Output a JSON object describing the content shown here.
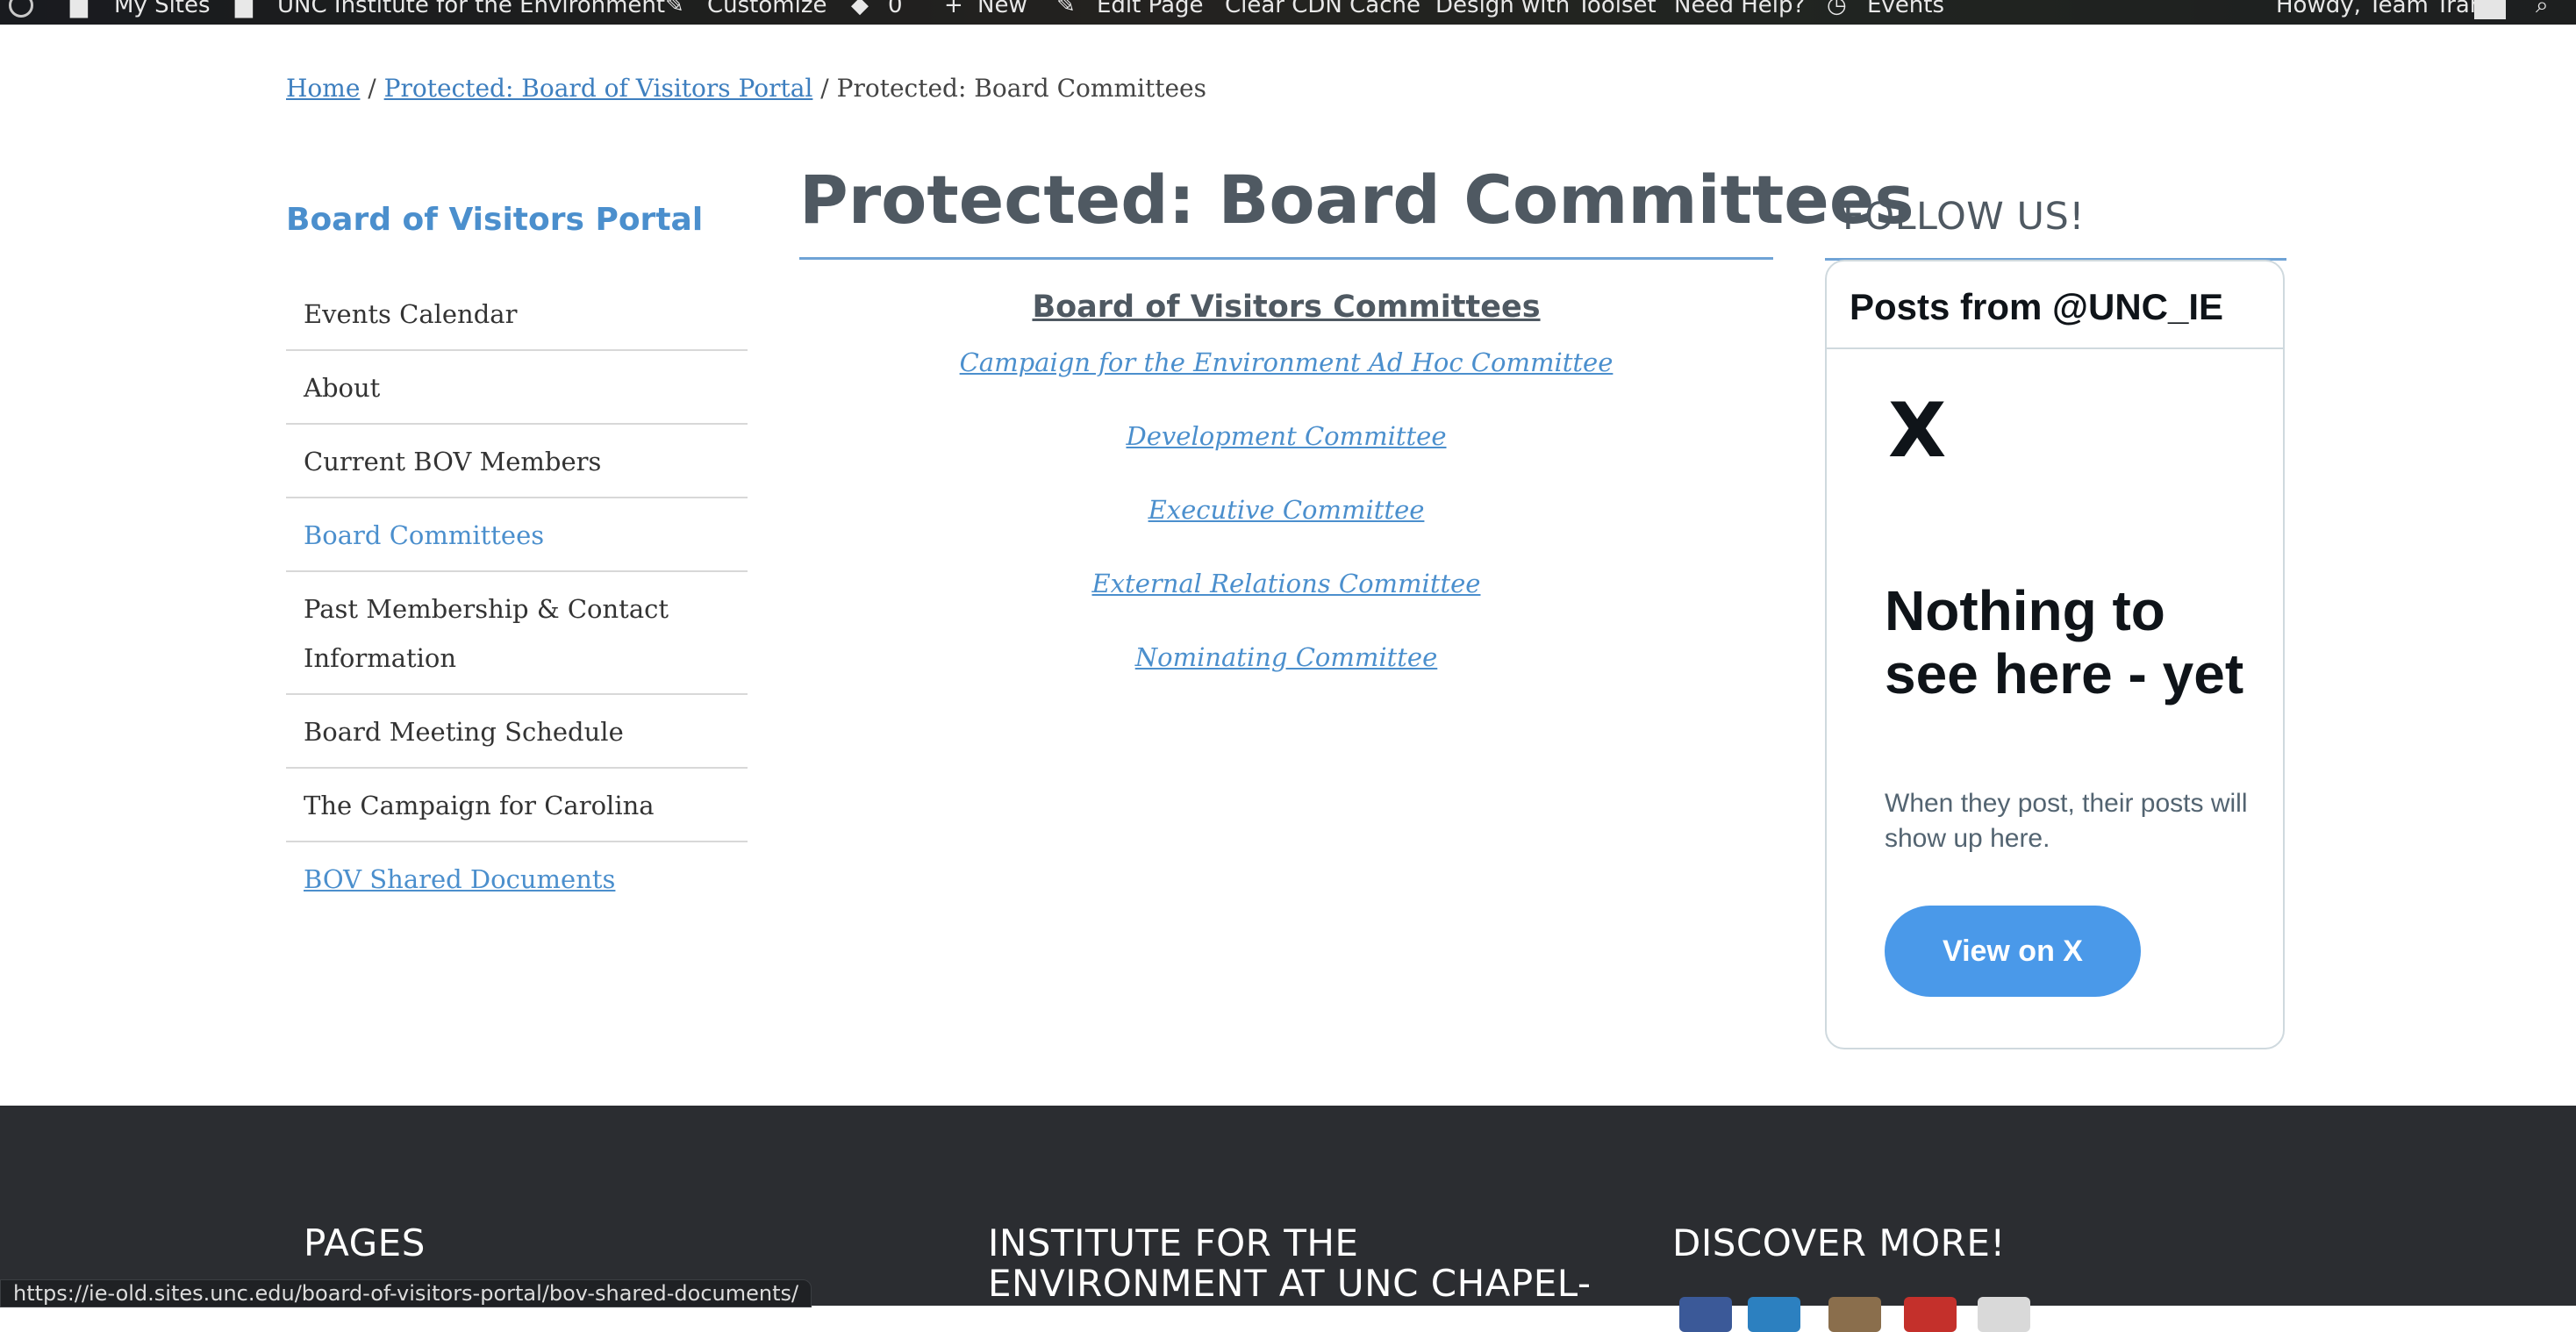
{
  "admin_bar": {
    "items": [
      "My Sites",
      "UNC Institute for the Environment",
      "Customize",
      "0",
      "New",
      "Edit Page",
      "Clear CDN Cache",
      "Design with Toolset",
      "Need Help?",
      "Events"
    ],
    "howdy": "Howdy, Team Tran"
  },
  "breadcrumb": {
    "home": "Home",
    "sep": " / ",
    "parent": "Protected: Board of Visitors Portal",
    "current": "Protected: Board Committees"
  },
  "sidebar": {
    "title": "Board of Visitors Portal",
    "items": [
      {
        "label": "Events Calendar"
      },
      {
        "label": "About"
      },
      {
        "label": "Current BOV Members"
      },
      {
        "label": "Board Committees"
      },
      {
        "label": "Past Membership & Contact Information"
      },
      {
        "label": "Board Meeting Schedule"
      },
      {
        "label": "The Campaign for Carolina"
      },
      {
        "label": "BOV Shared Documents"
      }
    ]
  },
  "main": {
    "title": "Protected: Board Committees",
    "subheading": "Board of Visitors Committees",
    "committees": [
      "Campaign for the Environment Ad Hoc Committee",
      "Development Committee",
      "Executive Committee",
      "External Relations Committee",
      "Nominating Committee"
    ]
  },
  "follow": {
    "title": "FOLLOW US!",
    "widget": {
      "header": "Posts from @UNC_IE",
      "logo": "X",
      "empty_title": "Nothing to see here - yet",
      "empty_sub": "When they post, their posts will show up here.",
      "button": "View on X"
    }
  },
  "footer": {
    "col1": "PAGES",
    "col2": "INSTITUTE FOR THE ENVIRONMENT AT UNC CHAPEL-",
    "col3": "DISCOVER MORE!"
  },
  "status_url": "https://ie-old.sites.unc.edu/board-of-visitors-portal/bov-shared-documents/",
  "colors": {
    "accent": "#4b8fcd",
    "heading": "#4f5962",
    "footer_bg": "#2b2d31",
    "x_button": "#4a99e9"
  }
}
